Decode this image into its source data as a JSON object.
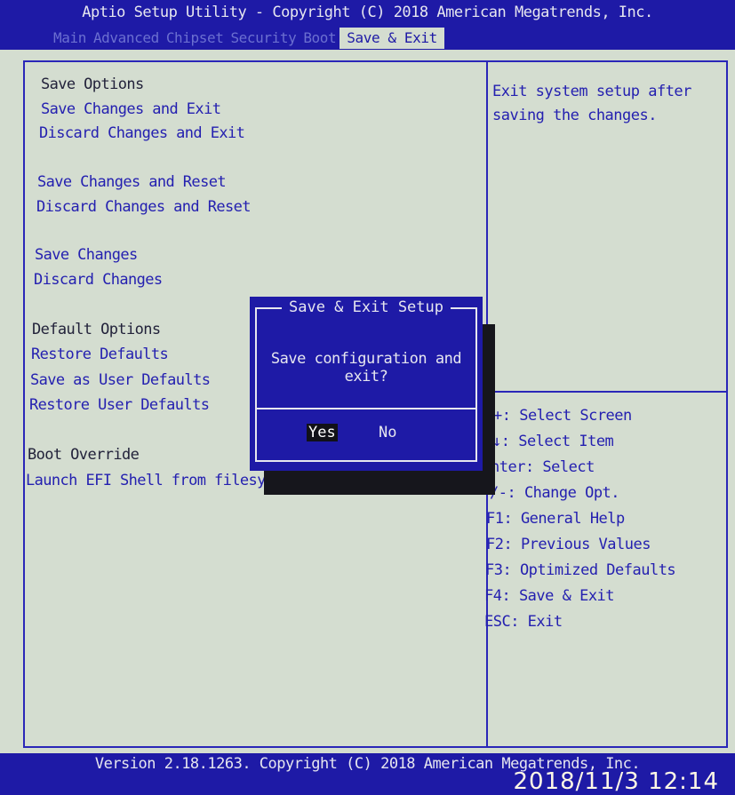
{
  "app": {
    "title": "Aptio Setup Utility - Copyright (C) 2018 American Megatrends, Inc."
  },
  "tabs": [
    {
      "label": "Main"
    },
    {
      "label": "Advanced"
    },
    {
      "label": "Chipset"
    },
    {
      "label": "Security"
    },
    {
      "label": "Boot"
    },
    {
      "label": "Save & Exit",
      "active": true
    }
  ],
  "menu": {
    "save_options_header": "Save Options",
    "save_changes_and_exit": "Save Changes and Exit",
    "discard_changes_and_exit": "Discard Changes and Exit",
    "save_changes_and_reset": "Save Changes and Reset",
    "discard_changes_and_reset": "Discard Changes and Reset",
    "save_changes": "Save Changes",
    "discard_changes": "Discard Changes",
    "default_options_header": "Default Options",
    "restore_defaults": "Restore Defaults",
    "save_as_user_defaults": "Save as User Defaults",
    "restore_user_defaults": "Restore User Defaults",
    "boot_override_header": "Boot Override",
    "launch_efi_shell": "Launch EFI Shell from filesystem"
  },
  "help": {
    "text": "Exit system setup after saving the changes."
  },
  "keys": [
    "+: Select Screen",
    "↓: Select Item",
    "nter: Select",
    "/-: Change Opt.",
    "F1: General Help",
    "F2: Previous Values",
    "F3: Optimized Defaults",
    "F4: Save & Exit",
    "ESC: Exit"
  ],
  "dialog": {
    "title": "Save & Exit Setup",
    "message": "Save configuration and exit?",
    "yes_label": "Yes",
    "no_label": "No",
    "selected": "Yes"
  },
  "footer": {
    "text": "Version 2.18.1263. Copyright (C) 2018 American Megatrends, Inc."
  },
  "photo_timestamp": "2018/11/3  12:14",
  "colors": {
    "bios_blue": "#1e1aa6",
    "panel_bg": "#d4ddd0",
    "option_text": "#2420b0",
    "header_text": "#22223a"
  }
}
